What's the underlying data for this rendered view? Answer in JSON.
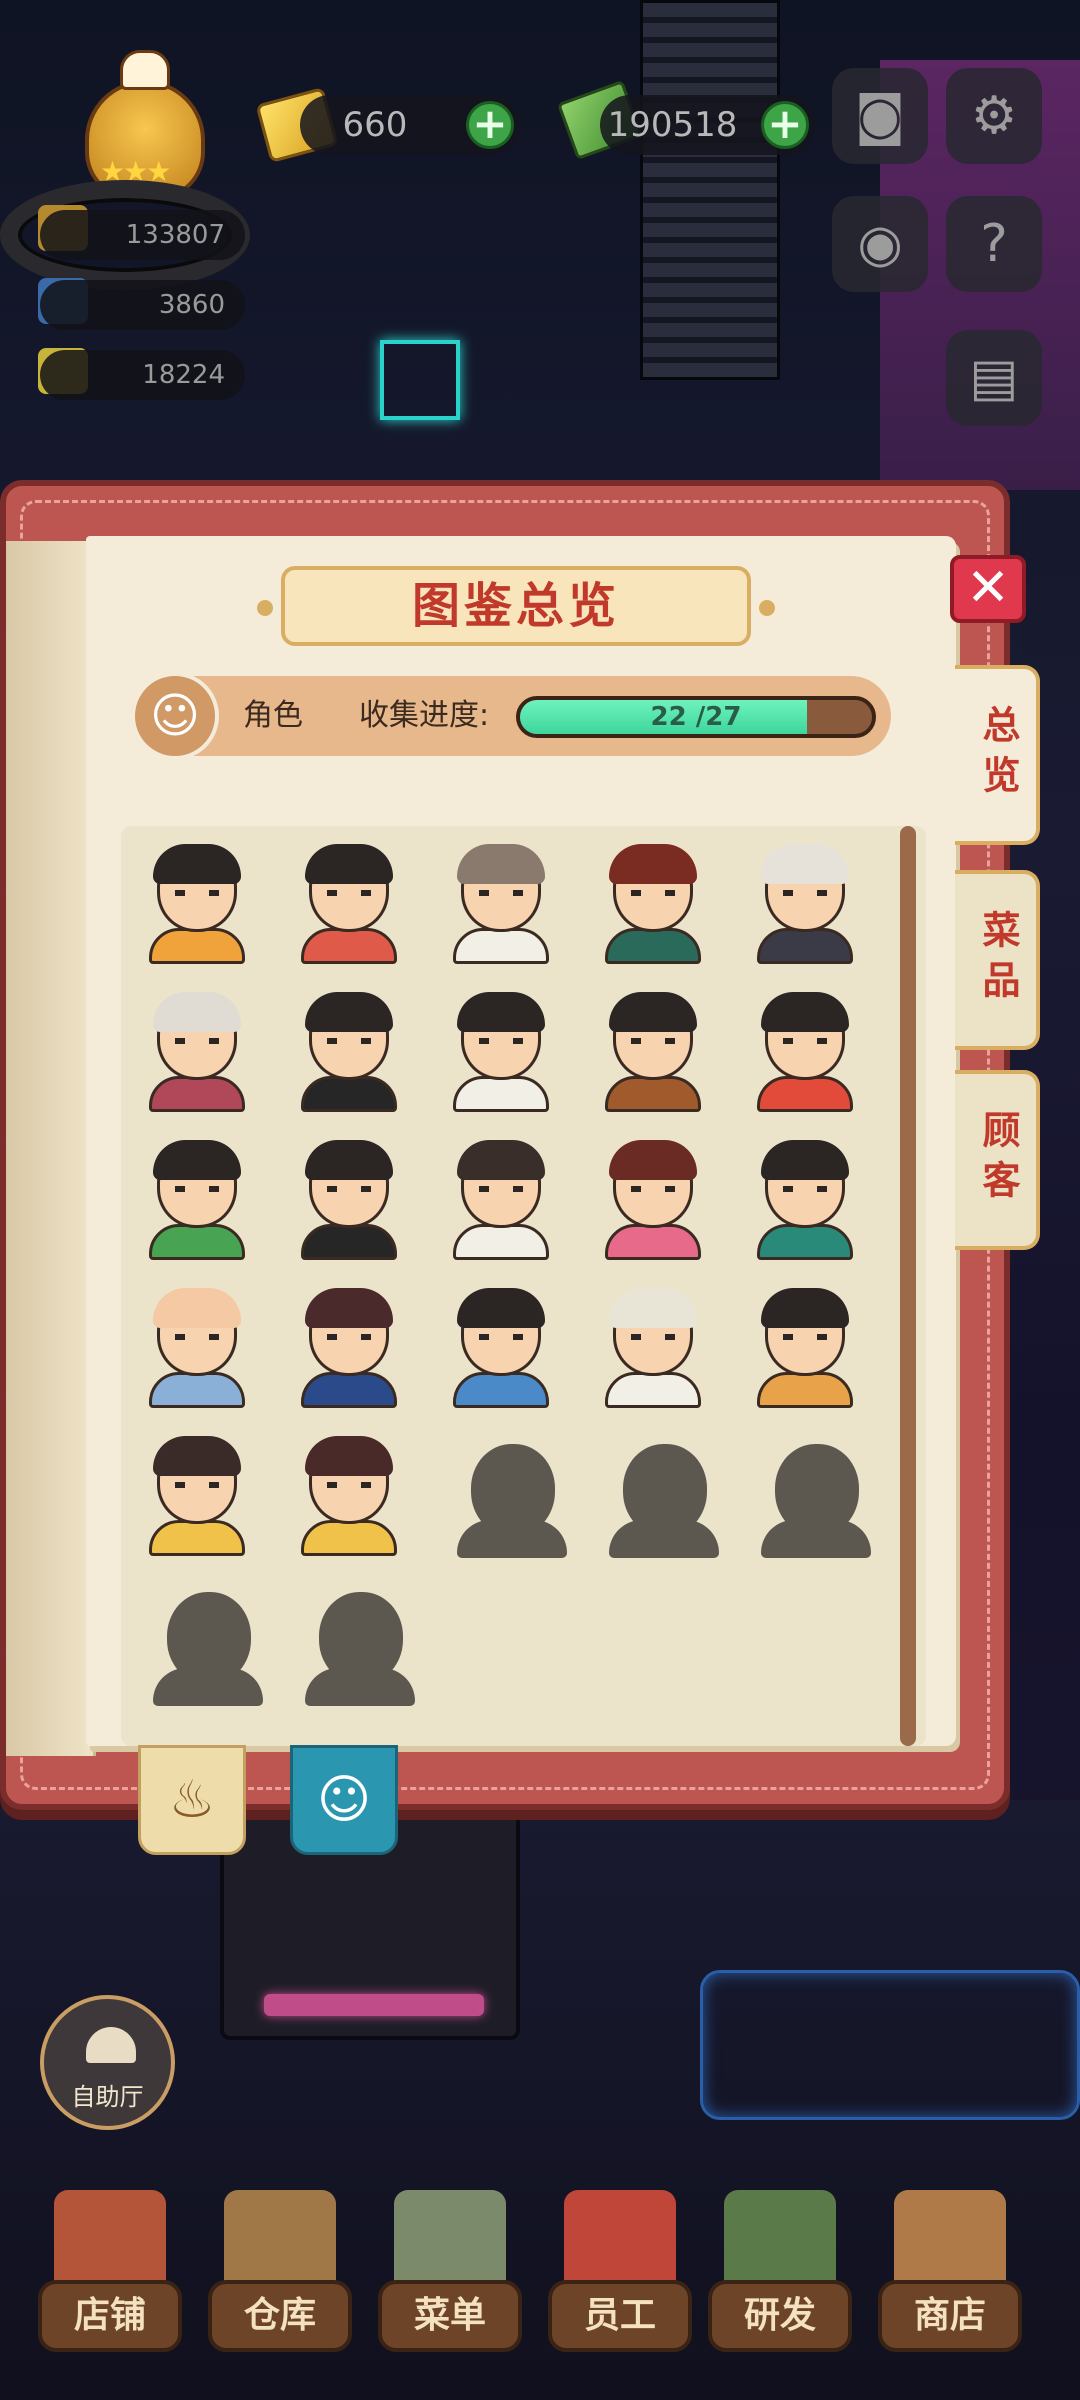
{
  "hud": {
    "gems": "660",
    "cash": "190518",
    "stat1": "133807",
    "stat2": "3860",
    "stat3": "18224"
  },
  "dialog": {
    "title": "图鉴总览",
    "category": "角色",
    "progress_label": "收集进度:",
    "progress_text": "22 /27",
    "progress_fraction": 0.815,
    "tabs": [
      "总览",
      "菜品",
      "顾客"
    ],
    "characters": [
      {
        "unlocked": true,
        "hair": "#2b2523",
        "shirt": "#f0a33a"
      },
      {
        "unlocked": true,
        "hair": "#2b2523",
        "shirt": "#e05a4a"
      },
      {
        "unlocked": true,
        "hair": "#8a7a6e",
        "shirt": "#f2f0e6"
      },
      {
        "unlocked": true,
        "hair": "#7a2b22",
        "shirt": "#2a6a5a"
      },
      {
        "unlocked": true,
        "hair": "#e6e2da",
        "shirt": "#3b3b48"
      },
      {
        "unlocked": true,
        "hair": "#e0dcd4",
        "shirt": "#b0485a"
      },
      {
        "unlocked": true,
        "hair": "#2b2523",
        "shirt": "#262626"
      },
      {
        "unlocked": true,
        "hair": "#2b2523",
        "shirt": "#f2f0e6"
      },
      {
        "unlocked": true,
        "hair": "#2b2523",
        "shirt": "#a05a2c"
      },
      {
        "unlocked": true,
        "hair": "#2b2523",
        "shirt": "#e24a3a"
      },
      {
        "unlocked": true,
        "hair": "#2b2523",
        "shirt": "#48a452"
      },
      {
        "unlocked": true,
        "hair": "#2b2523",
        "shirt": "#262626"
      },
      {
        "unlocked": true,
        "hair": "#3a2e2a",
        "shirt": "#f2f0e6"
      },
      {
        "unlocked": true,
        "hair": "#6a2b24",
        "shirt": "#e86a8a"
      },
      {
        "unlocked": true,
        "hair": "#2b2523",
        "shirt": "#2a8a7a"
      },
      {
        "unlocked": true,
        "hair": "#f4c9a4",
        "shirt": "#8ab0d8"
      },
      {
        "unlocked": true,
        "hair": "#4a2a2a",
        "shirt": "#2a4a8a"
      },
      {
        "unlocked": true,
        "hair": "#2b2523",
        "shirt": "#4a8ac8"
      },
      {
        "unlocked": true,
        "hair": "#e8e4d6",
        "shirt": "#f2f0e6"
      },
      {
        "unlocked": true,
        "hair": "#2b2523",
        "shirt": "#e8a24a"
      },
      {
        "unlocked": true,
        "hair": "#3a2a28",
        "shirt": "#f0c24a"
      },
      {
        "unlocked": true,
        "hair": "#4a2a28",
        "shirt": "#f0c24a"
      },
      {
        "unlocked": false
      },
      {
        "unlocked": false
      },
      {
        "unlocked": false
      },
      {
        "unlocked": false
      },
      {
        "unlocked": false
      }
    ]
  },
  "side": {
    "buffet_label": "自助厅"
  },
  "nav": [
    {
      "label": "店铺",
      "icon": "shop-building-icon",
      "color": "#b4553a"
    },
    {
      "label": "仓库",
      "icon": "warehouse-boxes-icon",
      "color": "#a07848"
    },
    {
      "label": "菜单",
      "icon": "menu-clipboard-icon",
      "color": "#7a8a6a"
    },
    {
      "label": "员工",
      "icon": "staff-chef-icon",
      "color": "#c0463a"
    },
    {
      "label": "研发",
      "icon": "research-pot-icon",
      "color": "#5a7a4a"
    },
    {
      "label": "商店",
      "icon": "store-front-icon",
      "color": "#b07a48"
    }
  ],
  "colors": {
    "accent_red": "#c0392b",
    "progress_green": "#3dd69c",
    "book_red": "#bd5550",
    "page": "#f4ecd9"
  }
}
